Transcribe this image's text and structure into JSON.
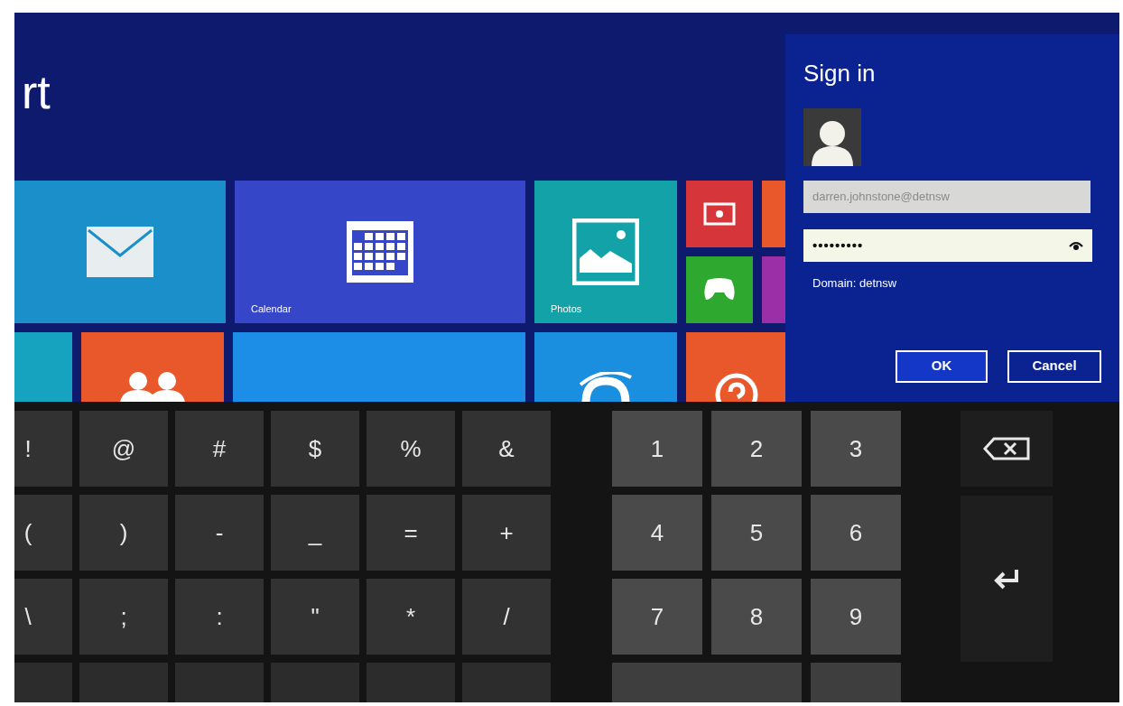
{
  "start_screen": {
    "title": "rt",
    "tile_rows": [
      [
        {
          "kind": "mail",
          "color": "#1a8fc9"
        },
        {
          "kind": "calendar",
          "label": "Calendar",
          "color": "#3546c8"
        },
        {
          "kind": "photos",
          "label": "Photos",
          "color": "#12a2a8"
        },
        {
          "kind": "pair",
          "items": [
            {
              "kind": "video",
              "color": "#d6353a"
            },
            {
              "kind": "game",
              "color": "#2ea82e"
            }
          ]
        },
        {
          "kind": "pair-cut",
          "items": [
            {
              "kind": "blank",
              "color": "#e8582a"
            },
            {
              "kind": "blank",
              "color": "#9a2fa8"
            }
          ]
        }
      ],
      [
        {
          "kind": "blank-small",
          "color": "#16a3c0"
        },
        {
          "kind": "people",
          "color": "#e8582a"
        },
        {
          "kind": "blank",
          "color": "#1d8ee8"
        },
        {
          "kind": "ie",
          "color": "#1a8fe0"
        },
        {
          "kind": "help",
          "color": "#e8582a"
        }
      ]
    ]
  },
  "sign_in": {
    "title": "Sign in",
    "username": "darren.johnstone@detnsw",
    "password": "•••••••••",
    "domain": "Domain: detnsw",
    "buttons": [
      {
        "label": "OK",
        "selected": true
      },
      {
        "label": "Cancel",
        "selected": false
      }
    ]
  },
  "keyboard": {
    "symbol_rows": [
      [
        "!",
        "@",
        "#",
        "$",
        "%",
        "&"
      ],
      [
        "(",
        ")",
        "-",
        "_",
        "=",
        "+"
      ],
      [
        "\\",
        ";",
        ":",
        "\"",
        "*",
        "/"
      ]
    ],
    "number_rows": [
      [
        "1",
        "2",
        "3"
      ],
      [
        "4",
        "5",
        "6"
      ],
      [
        "7",
        "8",
        "9"
      ]
    ],
    "side_keys": [
      {
        "kind": "backspace"
      },
      {
        "kind": "enter"
      }
    ]
  }
}
